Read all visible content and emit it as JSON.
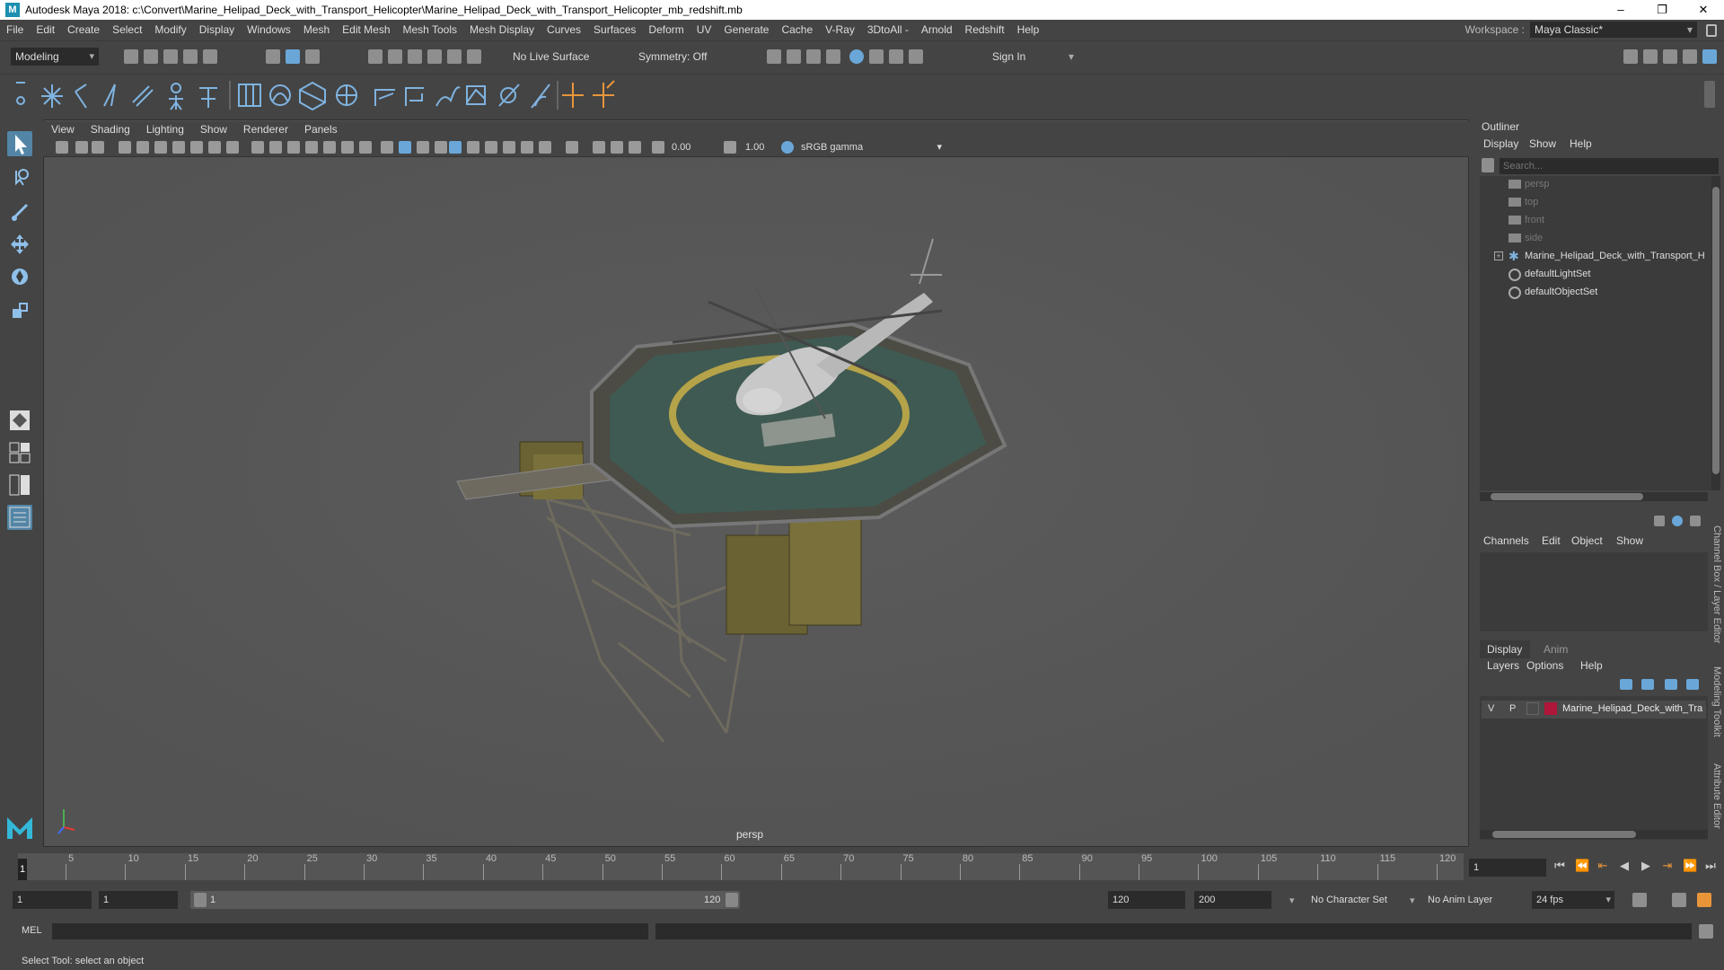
{
  "window": {
    "title": "Autodesk Maya 2018: c:\\Convert\\Marine_Helipad_Deck_with_Transport_Helicopter\\Marine_Helipad_Deck_with_Transport_Helicopter_mb_redshift.mb",
    "logo_letter": "M"
  },
  "menubar": {
    "items": [
      "File",
      "Edit",
      "Create",
      "Select",
      "Modify",
      "Display",
      "Windows",
      "Mesh",
      "Edit Mesh",
      "Mesh Tools",
      "Mesh Display",
      "Curves",
      "Surfaces",
      "Deform",
      "UV",
      "Generate",
      "Cache",
      "V-Ray",
      "3DtoAll -",
      "Arnold",
      "Redshift",
      "Help"
    ],
    "workspace_label": "Workspace :",
    "workspace_value": "Maya Classic*"
  },
  "statusline": {
    "mode": "Modeling",
    "live_surface": "No Live Surface",
    "symmetry": "Symmetry: Off",
    "sign_in": "Sign In"
  },
  "viewport": {
    "menus": [
      "View",
      "Shading",
      "Lighting",
      "Show",
      "Renderer",
      "Panels"
    ],
    "exposure": "0.00",
    "gamma": "1.00",
    "color_space": "sRGB gamma",
    "camera": "persp"
  },
  "outliner": {
    "title": "Outliner",
    "menus": [
      "Display",
      "Show",
      "Help"
    ],
    "search_placeholder": "Search...",
    "items": [
      {
        "label": "persp",
        "dim": true,
        "icon": "camera-icon"
      },
      {
        "label": "top",
        "dim": true,
        "icon": "camera-icon"
      },
      {
        "label": "front",
        "dim": true,
        "icon": "camera-icon"
      },
      {
        "label": "side",
        "dim": true,
        "icon": "camera-icon"
      },
      {
        "label": "Marine_Helipad_Deck_with_Transport_H",
        "dim": false,
        "icon": "group-icon"
      },
      {
        "label": "defaultLightSet",
        "dim": false,
        "icon": "set-icon"
      },
      {
        "label": "defaultObjectSet",
        "dim": false,
        "icon": "set-icon"
      }
    ]
  },
  "channelbox": {
    "menus": [
      "Channels",
      "Edit",
      "Object",
      "Show"
    ]
  },
  "layereditor": {
    "tabs": [
      "Display",
      "Anim"
    ],
    "menus": [
      "Layers",
      "Options",
      "Help"
    ],
    "layer": {
      "v": "V",
      "p": "P",
      "name": "Marine_Helipad_Deck_with_Tra",
      "color": "#b0153a"
    }
  },
  "side_tabs": [
    "Channel Box / Layer Editor",
    "Modeling Toolkit",
    "Attribute Editor"
  ],
  "timeslider": {
    "ticks": [
      "5",
      "10",
      "15",
      "20",
      "25",
      "30",
      "35",
      "40",
      "45",
      "50",
      "55",
      "60",
      "65",
      "70",
      "75",
      "80",
      "85",
      "90",
      "95",
      "100",
      "105",
      "110",
      "115",
      "120"
    ],
    "current_frame": "1",
    "current_field": "1"
  },
  "rangeslider": {
    "start": "1",
    "playback_start": "1",
    "range_start": "1",
    "range_end": "120",
    "playback_end": "120",
    "end": "200",
    "character_set": "No Character Set",
    "anim_layer": "No Anim Layer",
    "fps": "24 fps"
  },
  "cmdline": {
    "label": "MEL"
  },
  "helpline": {
    "text": "Select Tool: select an object"
  }
}
